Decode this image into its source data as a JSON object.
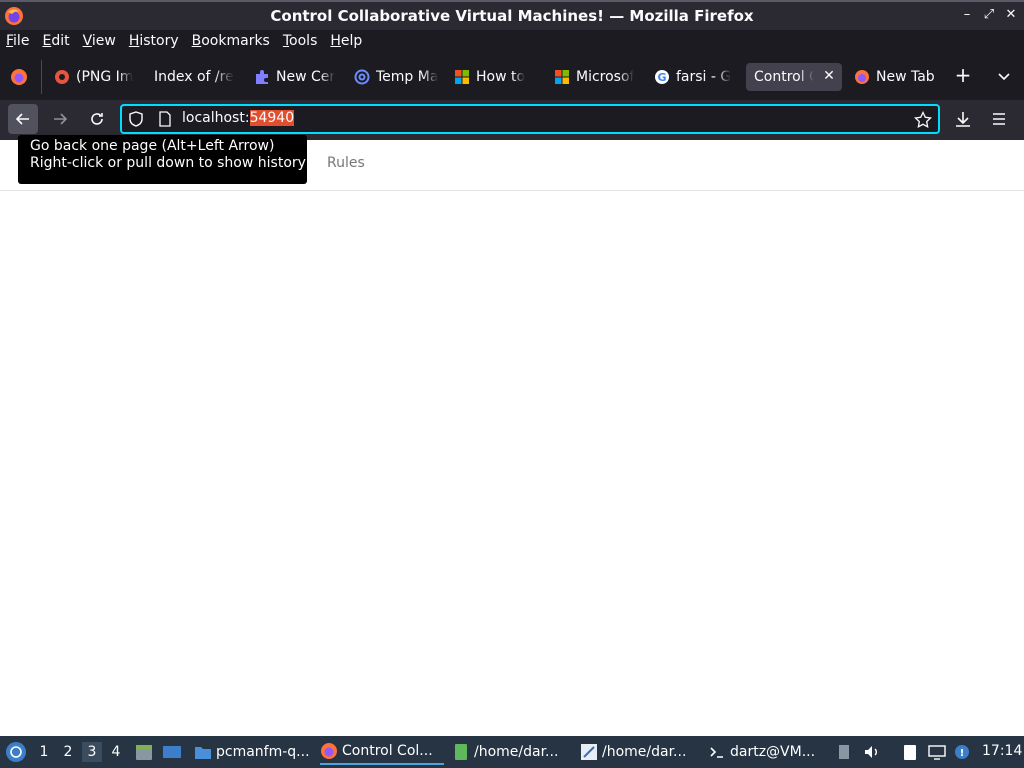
{
  "window": {
    "title": "Control Collaborative Virtual Machines! — Mozilla Firefox"
  },
  "menubar": {
    "items": [
      "File",
      "Edit",
      "View",
      "History",
      "Bookmarks",
      "Tools",
      "Help"
    ]
  },
  "tabs": [
    {
      "label": "(PNG Im",
      "icon": "png-viewer-icon"
    },
    {
      "label": "Index of /re",
      "icon": ""
    },
    {
      "label": "New Cer",
      "icon": "puzzle-icon"
    },
    {
      "label": "Temp Ma",
      "icon": "at-sign-icon"
    },
    {
      "label": "How to",
      "icon": "windows-logo-icon"
    },
    {
      "label": "Microsof",
      "icon": "microsoft-logo-icon"
    },
    {
      "label": "farsi - G",
      "icon": "google-logo-icon"
    },
    {
      "label": "Control C",
      "icon": "",
      "active": true
    },
    {
      "label": "New Tab",
      "icon": "firefox-icon"
    }
  ],
  "navbar": {
    "url_host": "localhost:",
    "url_port": "54940"
  },
  "page": {
    "nav_item": "Rules"
  },
  "tooltip": {
    "line1": "Go back one page (Alt+Left Arrow)",
    "line2": "Right-click or pull down to show history"
  },
  "taskbar": {
    "workspaces": [
      "1",
      "2",
      "3",
      "4"
    ],
    "active_workspace": "3",
    "tasks": [
      {
        "label": "pcmanfm-q...",
        "icon": "folder-icon"
      },
      {
        "label": "Control Col...",
        "icon": "firefox-icon",
        "active": true
      },
      {
        "label": "/home/dar...",
        "icon": "text-editor-icon"
      },
      {
        "label": "/home/dar...",
        "icon": "feather-editor-icon"
      },
      {
        "label": "dartz@VM...",
        "icon": "terminal-icon"
      }
    ],
    "clock": "17:14"
  }
}
